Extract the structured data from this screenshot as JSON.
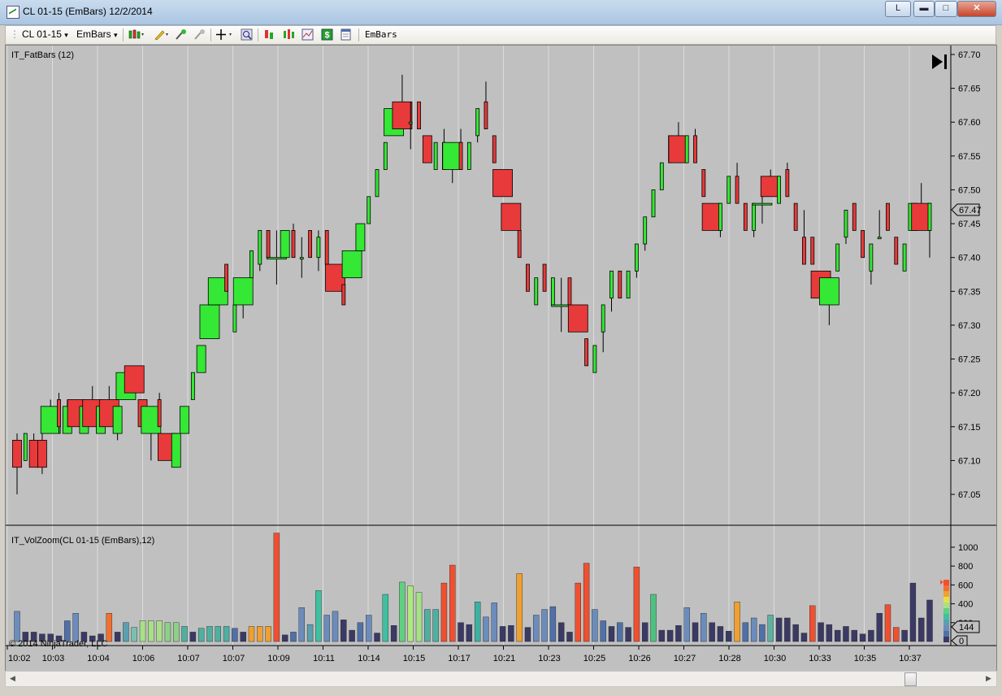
{
  "window": {
    "title": "CL 01-15 (EmBars)  12/2/2014",
    "buttons": {
      "layout": "L",
      "minimize": "▬",
      "maximize": "□",
      "close": "✕"
    }
  },
  "toolbar": {
    "instrument": "CL 01-15",
    "bar_type": "EmBars",
    "label": "EmBars",
    "dropdown_icon": "▾",
    "icons": [
      "bar-style-icon",
      "pencil-icon",
      "add-indicator-icon",
      "remove-indicator-icon",
      "crosshair-icon",
      "zoom-icon",
      "strategy-icon",
      "indicators-icon",
      "chart-trader-icon",
      "dollar-icon",
      "properties-icon"
    ]
  },
  "colors": {
    "up": "#35e835",
    "down": "#e83a3a",
    "bg": "#c0c0c0"
  },
  "chart_data": [
    {
      "type": "candlestick",
      "title": "IT_FatBars (12)",
      "ylim": [
        67.02,
        67.71
      ],
      "yticks": [
        "67.70",
        "67.65",
        "67.60",
        "67.55",
        "67.50",
        "67.45",
        "67.40",
        "67.35",
        "67.30",
        "67.25",
        "67.20",
        "67.15",
        "67.10",
        "67.05"
      ],
      "last_price": "67.47",
      "bars": [
        [
          0,
          67.13,
          67.14,
          67.05,
          67.09,
          1
        ],
        [
          1,
          67.1,
          67.14,
          67.1,
          67.14,
          0
        ],
        [
          2,
          67.13,
          67.14,
          67.09,
          67.09,
          1
        ],
        [
          3,
          67.13,
          67.14,
          67.08,
          67.09,
          1
        ],
        [
          4,
          67.14,
          67.19,
          67.14,
          67.18,
          2
        ],
        [
          5,
          67.19,
          67.2,
          67.14,
          67.15,
          0
        ],
        [
          6,
          67.14,
          67.19,
          67.14,
          67.18,
          1
        ],
        [
          7,
          67.19,
          67.19,
          67.15,
          67.15,
          3
        ],
        [
          8,
          67.14,
          67.18,
          67.14,
          67.18,
          1
        ],
        [
          9,
          67.19,
          67.21,
          67.15,
          67.15,
          2
        ],
        [
          10,
          67.14,
          67.19,
          67.14,
          67.18,
          1
        ],
        [
          11,
          67.19,
          67.21,
          67.15,
          67.15,
          2
        ],
        [
          12,
          67.14,
          67.18,
          67.13,
          67.18,
          1
        ],
        [
          13,
          67.19,
          67.23,
          67.19,
          67.23,
          2
        ],
        [
          14,
          67.24,
          67.24,
          67.2,
          67.2,
          2
        ],
        [
          15,
          67.19,
          67.19,
          67.15,
          67.15,
          1
        ],
        [
          16,
          67.14,
          67.18,
          67.1,
          67.18,
          2
        ],
        [
          17,
          67.19,
          67.2,
          67.15,
          67.15,
          0
        ],
        [
          18,
          67.14,
          67.14,
          67.1,
          67.1,
          2
        ],
        [
          19,
          67.09,
          67.14,
          67.09,
          67.14,
          1
        ],
        [
          20,
          67.14,
          67.18,
          67.14,
          67.18,
          1
        ],
        [
          21,
          67.19,
          67.23,
          67.19,
          67.23,
          0
        ],
        [
          22,
          67.23,
          67.27,
          67.23,
          67.27,
          1
        ],
        [
          23,
          67.28,
          67.33,
          67.28,
          67.33,
          2
        ],
        [
          24,
          67.33,
          67.37,
          67.33,
          67.37,
          2
        ],
        [
          25,
          67.39,
          67.39,
          67.35,
          67.35,
          0
        ],
        [
          26,
          67.29,
          67.33,
          67.29,
          67.33,
          0
        ],
        [
          27,
          67.33,
          67.37,
          67.31,
          67.37,
          2
        ],
        [
          28,
          67.37,
          67.41,
          67.37,
          67.41,
          0
        ],
        [
          29,
          67.39,
          67.44,
          67.38,
          67.44,
          0
        ],
        [
          30,
          67.44,
          67.44,
          67.4,
          67.4,
          0
        ],
        [
          31,
          67.4,
          67.44,
          67.36,
          67.4,
          2
        ],
        [
          32,
          67.4,
          67.44,
          67.4,
          67.44,
          1
        ],
        [
          33,
          67.44,
          67.45,
          67.4,
          67.4,
          0
        ],
        [
          34,
          67.4,
          67.43,
          67.37,
          67.4,
          0
        ],
        [
          35,
          67.44,
          67.44,
          67.4,
          67.4,
          0
        ],
        [
          36,
          67.4,
          67.44,
          67.38,
          67.43,
          0
        ],
        [
          37,
          67.44,
          67.44,
          67.39,
          67.39,
          0
        ],
        [
          38,
          67.39,
          67.39,
          67.35,
          67.35,
          2
        ],
        [
          39,
          67.36,
          67.36,
          67.33,
          67.33,
          0
        ],
        [
          40,
          67.37,
          67.41,
          67.37,
          67.41,
          2
        ],
        [
          41,
          67.41,
          67.45,
          67.41,
          67.45,
          1
        ],
        [
          42,
          67.45,
          67.49,
          67.45,
          67.49,
          0
        ],
        [
          43,
          67.49,
          67.53,
          67.49,
          67.53,
          0
        ],
        [
          44,
          67.53,
          67.57,
          67.53,
          67.57,
          0
        ],
        [
          45,
          67.58,
          67.62,
          67.58,
          67.62,
          2
        ],
        [
          46,
          67.63,
          67.67,
          67.59,
          67.59,
          2
        ],
        [
          47,
          67.6,
          67.63,
          67.56,
          67.6,
          0
        ],
        [
          48,
          67.63,
          67.63,
          67.59,
          67.59,
          0
        ],
        [
          49,
          67.58,
          67.58,
          67.54,
          67.54,
          1
        ],
        [
          50,
          67.53,
          67.57,
          67.53,
          67.57,
          0
        ],
        [
          51,
          67.57,
          67.59,
          67.53,
          67.53,
          0
        ],
        [
          52,
          67.53,
          67.57,
          67.51,
          67.57,
          2
        ],
        [
          53,
          67.57,
          67.59,
          67.53,
          67.53,
          0
        ],
        [
          54,
          67.53,
          67.57,
          67.53,
          67.57,
          0
        ],
        [
          55,
          67.58,
          67.62,
          67.57,
          67.62,
          0
        ],
        [
          56,
          67.63,
          67.66,
          67.59,
          67.59,
          0
        ],
        [
          57,
          67.58,
          67.58,
          67.54,
          67.54,
          0
        ],
        [
          58,
          67.53,
          67.53,
          67.49,
          67.49,
          2
        ],
        [
          59,
          67.48,
          67.48,
          67.44,
          67.44,
          2
        ],
        [
          60,
          67.44,
          67.44,
          67.4,
          67.4,
          0
        ],
        [
          61,
          67.39,
          67.39,
          67.35,
          67.35,
          0
        ],
        [
          62,
          67.33,
          67.37,
          67.33,
          67.37,
          0
        ],
        [
          63,
          67.39,
          67.39,
          67.35,
          67.35,
          0
        ],
        [
          64,
          67.33,
          67.37,
          67.33,
          67.37,
          0
        ],
        [
          65,
          67.33,
          67.37,
          67.29,
          67.33,
          2
        ],
        [
          66,
          67.37,
          67.37,
          67.33,
          67.33,
          0
        ],
        [
          67,
          67.33,
          67.33,
          67.29,
          67.29,
          2
        ],
        [
          68,
          67.28,
          67.28,
          67.24,
          67.24,
          0
        ],
        [
          69,
          67.23,
          67.27,
          67.23,
          67.27,
          0
        ],
        [
          70,
          67.29,
          67.33,
          67.26,
          67.33,
          0
        ],
        [
          71,
          67.34,
          67.38,
          67.32,
          67.38,
          0
        ],
        [
          72,
          67.38,
          67.38,
          67.34,
          67.34,
          0
        ],
        [
          73,
          67.34,
          67.38,
          67.34,
          67.38,
          0
        ],
        [
          74,
          67.38,
          67.42,
          67.37,
          67.42,
          0
        ],
        [
          75,
          67.42,
          67.46,
          67.41,
          67.46,
          0
        ],
        [
          76,
          67.46,
          67.5,
          67.46,
          67.5,
          0
        ],
        [
          77,
          67.5,
          67.54,
          67.5,
          67.54,
          0
        ],
        [
          78,
          67.54,
          67.58,
          67.54,
          67.58,
          0
        ],
        [
          79,
          67.58,
          67.6,
          67.54,
          67.54,
          2
        ],
        [
          80,
          67.54,
          67.58,
          67.54,
          67.58,
          0
        ],
        [
          81,
          67.58,
          67.59,
          67.54,
          67.54,
          0
        ],
        [
          82,
          67.53,
          67.53,
          67.49,
          67.49,
          0
        ],
        [
          83,
          67.48,
          67.48,
          67.44,
          67.44,
          2
        ],
        [
          84,
          67.44,
          67.48,
          67.43,
          67.48,
          0
        ],
        [
          85,
          67.48,
          67.52,
          67.48,
          67.52,
          0
        ],
        [
          86,
          67.52,
          67.54,
          67.48,
          67.48,
          0
        ],
        [
          87,
          67.48,
          67.48,
          67.44,
          67.44,
          0
        ],
        [
          88,
          67.44,
          67.48,
          67.43,
          67.48,
          0
        ],
        [
          89,
          67.48,
          67.52,
          67.45,
          67.48,
          2
        ],
        [
          90,
          67.52,
          67.53,
          67.49,
          67.49,
          2
        ],
        [
          91,
          67.48,
          67.52,
          67.48,
          67.52,
          0
        ],
        [
          92,
          67.53,
          67.54,
          67.49,
          67.49,
          0
        ],
        [
          93,
          67.48,
          67.48,
          67.44,
          67.44,
          0
        ],
        [
          94,
          67.43,
          67.47,
          67.39,
          67.39,
          0
        ],
        [
          95,
          67.43,
          67.43,
          67.39,
          67.39,
          0
        ],
        [
          96,
          67.38,
          67.38,
          67.34,
          67.34,
          2
        ],
        [
          97,
          67.33,
          67.37,
          67.3,
          67.37,
          2
        ],
        [
          98,
          67.38,
          67.42,
          67.38,
          67.42,
          0
        ],
        [
          99,
          67.43,
          67.47,
          67.42,
          67.47,
          0
        ],
        [
          100,
          67.48,
          67.48,
          67.44,
          67.44,
          0
        ],
        [
          101,
          67.44,
          67.44,
          67.4,
          67.4,
          0
        ],
        [
          102,
          67.38,
          67.42,
          67.36,
          67.42,
          0
        ],
        [
          103,
          67.43,
          67.47,
          67.43,
          67.43,
          0
        ],
        [
          104,
          67.48,
          67.48,
          67.44,
          67.44,
          0
        ],
        [
          105,
          67.43,
          67.43,
          67.39,
          67.39,
          0
        ],
        [
          106,
          67.38,
          67.42,
          67.38,
          67.42,
          0
        ],
        [
          107,
          67.44,
          67.48,
          67.44,
          67.48,
          1
        ],
        [
          108,
          67.48,
          67.51,
          67.44,
          67.44,
          2
        ],
        [
          109,
          67.44,
          67.48,
          67.4,
          67.48,
          0
        ]
      ]
    },
    {
      "type": "bar",
      "title": "IT_VolZoom(CL 01-15 (EmBars),12)",
      "ylim": [
        0,
        1150
      ],
      "yticks": [
        "1000",
        "800",
        "600",
        "400",
        "200",
        "0"
      ],
      "labels": {
        "current": "144",
        "zero": "0"
      },
      "values": [
        320,
        100,
        100,
        80,
        80,
        60,
        220,
        300,
        100,
        60,
        80,
        300,
        100,
        200,
        150,
        220,
        220,
        220,
        200,
        200,
        160,
        100,
        140,
        160,
        160,
        160,
        140,
        100,
        160,
        160,
        160,
        1150,
        70,
        100,
        360,
        180,
        540,
        280,
        320,
        230,
        120,
        200,
        280,
        90,
        500,
        170,
        630,
        590,
        520,
        340,
        340,
        620,
        810,
        200,
        180,
        420,
        260,
        410,
        160,
        170,
        720,
        150,
        280,
        340,
        370,
        200,
        100,
        620,
        830,
        340,
        220,
        160,
        200,
        150,
        790,
        200,
        500,
        120,
        120,
        170,
        360,
        200,
        300,
        200,
        160,
        110,
        420,
        200,
        250,
        180,
        280,
        250,
        250,
        180,
        90,
        380,
        200,
        180,
        120,
        160,
        120,
        80,
        120,
        300,
        390,
        150,
        120,
        620,
        250,
        440
      ],
      "colors": [
        "#6c8cbc",
        "#3a3a64",
        "#3a3a64",
        "#3a3a64",
        "#3a3a64",
        "#3a3a64",
        "#5070a8",
        "#6c8cbc",
        "#3a3a64",
        "#3a3a64",
        "#3a3a64",
        "#f07030",
        "#3a3a64",
        "#5aa0b0",
        "#7ac0b0",
        "#a8e088",
        "#a8e088",
        "#a8e088",
        "#8ed088",
        "#8ed088",
        "#50b0a0",
        "#3a3a64",
        "#50b0a0",
        "#50b0a0",
        "#50b0a0",
        "#50b0a0",
        "#5070a8",
        "#3a3a64",
        "#f0a030",
        "#f0a030",
        "#f0a030",
        "#f05030",
        "#3a3a64",
        "#5070a8",
        "#6c8cbc",
        "#5aa0b0",
        "#40c0a0",
        "#6c8cbc",
        "#6c8cbc",
        "#3a3a64",
        "#3a3a64",
        "#5070a8",
        "#6c8cbc",
        "#3a3a64",
        "#40c0a0",
        "#3a3a64",
        "#60d080",
        "#b0e880",
        "#a8e088",
        "#50b0a0",
        "#50b0a0",
        "#f05030",
        "#f05030",
        "#3a3a64",
        "#3a3a64",
        "#40b0a0",
        "#6c8cbc",
        "#6c8cbc",
        "#3a3a64",
        "#3a3a64",
        "#f0a030",
        "#3a3a64",
        "#6c8cbc",
        "#6c8cbc",
        "#5070a8",
        "#3a3a64",
        "#3a3a64",
        "#f05030",
        "#f05030",
        "#6c8cbc",
        "#5070a8",
        "#3a3a64",
        "#5070a8",
        "#3a3a64",
        "#f05030",
        "#3a3a64",
        "#50c080",
        "#3a3a64",
        "#3a3a64",
        "#3a3a64",
        "#6c8cbc",
        "#3a3a64",
        "#6c8cbc",
        "#3a3a64",
        "#3a3a64",
        "#3a3a64",
        "#f0a030",
        "#5070a8",
        "#6c8cbc",
        "#5070a8",
        "#60b0a0",
        "#3a3a64",
        "#3a3a64",
        "#3a3a64",
        "#3a3a64",
        "#f05030",
        "#3a3a64",
        "#3a3a64",
        "#3a3a64",
        "#3a3a64",
        "#3a3a64",
        "#3a3a64",
        "#3a3a64",
        "#3a3a64",
        "#f05030",
        "#f05030",
        "#3a3a64",
        "#3a3a64",
        "#3a3a64",
        "#3a3a64"
      ]
    }
  ],
  "xaxis": {
    "labels": [
      "10:02",
      "10:03",
      "10:04",
      "10:06",
      "10:07",
      "10:07",
      "10:09",
      "10:11",
      "10:14",
      "10:15",
      "10:17",
      "10:21",
      "10:23",
      "10:25",
      "10:26",
      "10:27",
      "10:28",
      "10:30",
      "10:33",
      "10:35",
      "10:37"
    ]
  },
  "copyright": "© 2014 NinjaTrader, LLC"
}
